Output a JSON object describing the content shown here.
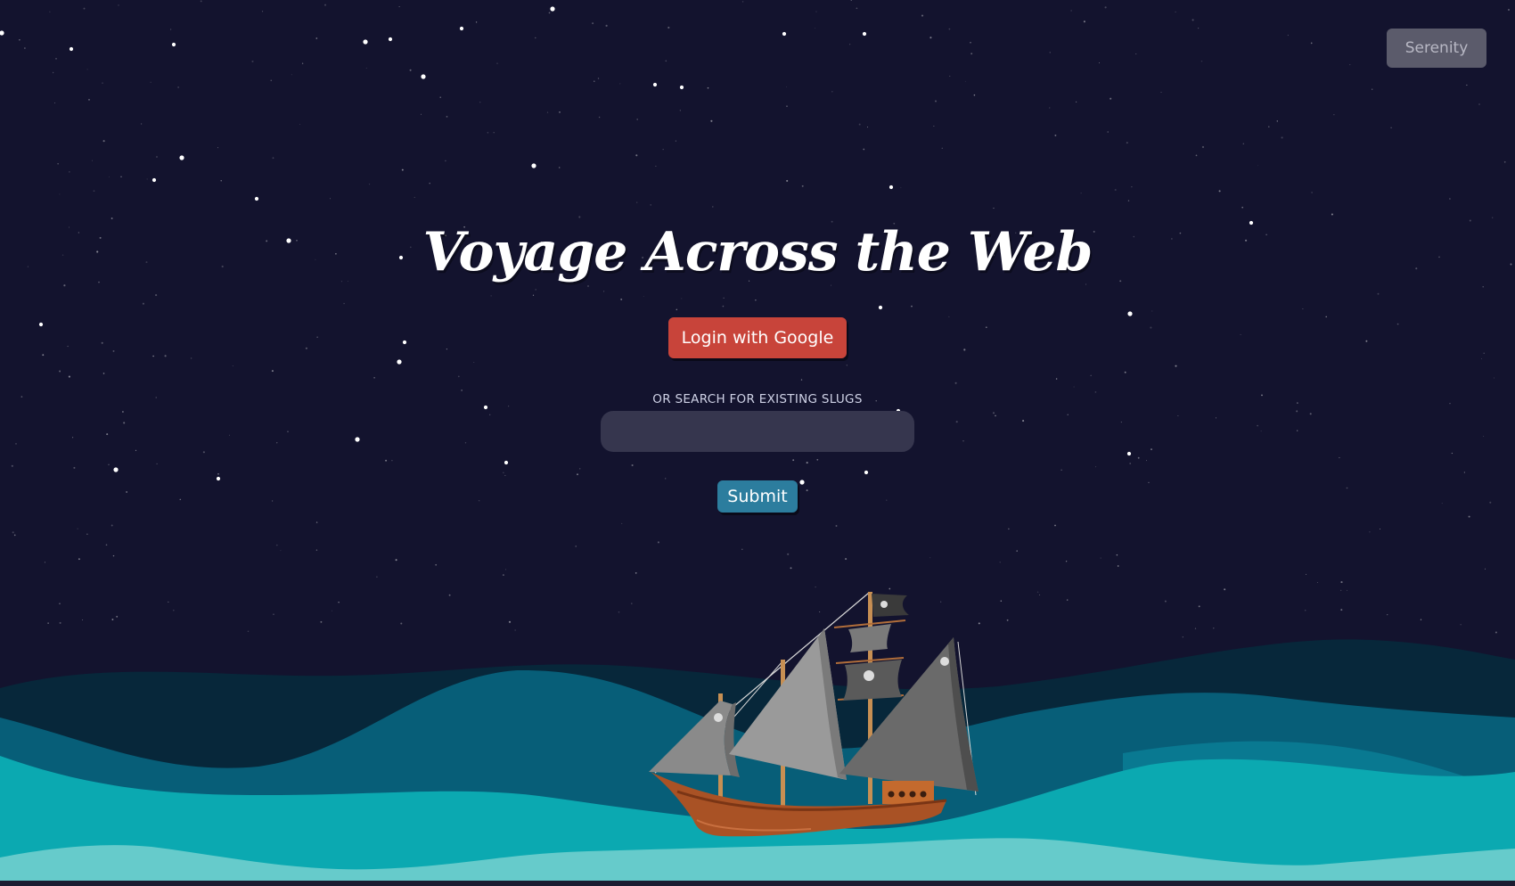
{
  "header": {
    "theme_label": "Serenity"
  },
  "hero": {
    "title": "Voyage Across the Web",
    "login_label": "Login with Google"
  },
  "search": {
    "label": "OR SEARCH FOR EXISTING SLUGS",
    "value": "",
    "placeholder": "",
    "submit_label": "Submit"
  },
  "scene": {
    "ship_icon": "pirate-ship-icon",
    "flag_icon": "jolly-roger-icon"
  },
  "colors": {
    "background": "#13132e",
    "login_button": "#c8443a",
    "submit_button": "#2c7d9e",
    "theme_button": "#5b5b6b",
    "input_bg": "#36364e",
    "wave_dark": "#07273a",
    "wave_mid": "#075e78",
    "wave_teal": "#0ba9b1",
    "wave_light": "#66cbcb"
  }
}
